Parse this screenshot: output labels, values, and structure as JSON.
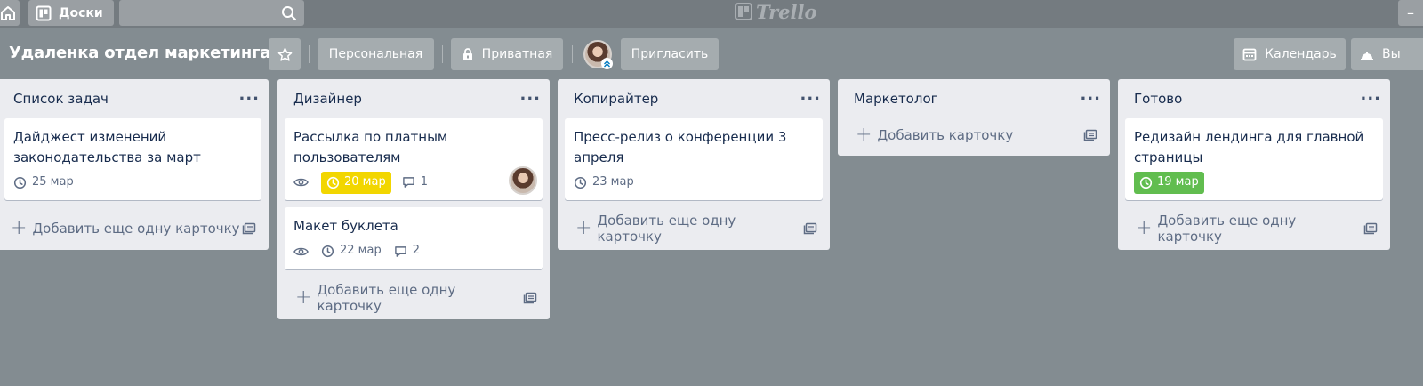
{
  "topbar": {
    "boards_label": "Доски",
    "logo_text": "Trello"
  },
  "header": {
    "board_title": "Удаленка отдел маркетинга",
    "team_label": "Персональная",
    "visibility_label": "Приватная",
    "invite_label": "Пригласить",
    "calendar_label": "Календарь",
    "partial_label": "Вы"
  },
  "colors": {
    "background": "#838c91",
    "due_soon": "#f2d600",
    "due_complete": "#61bd4f"
  },
  "lists": [
    {
      "title": "Список задач",
      "add_label": "Добавить еще одну карточку",
      "cards": [
        {
          "title": "Дайджест изменений законодательства за март",
          "due": "25 мар"
        }
      ]
    },
    {
      "title": "Дизайнер",
      "add_label": "Добавить еще одну карточку",
      "cards": [
        {
          "title": "Рассылка по платным пользователям",
          "due": "20 мар",
          "comments": "1"
        },
        {
          "title": "Макет буклета",
          "due": "22 мар",
          "comments": "2"
        }
      ]
    },
    {
      "title": "Копирайтер",
      "add_label": "Добавить еще одну карточку",
      "cards": [
        {
          "title": "Пресс-релиз о конференции 3 апреля",
          "due": "23 мар"
        }
      ]
    },
    {
      "title": "Маркетолог",
      "add_label": "Добавить карточку",
      "cards": []
    },
    {
      "title": "Готово",
      "add_label": "Добавить еще одну карточку",
      "cards": [
        {
          "title": "Редизайн лендинга для главной страницы",
          "due": "19 мар"
        }
      ]
    }
  ]
}
